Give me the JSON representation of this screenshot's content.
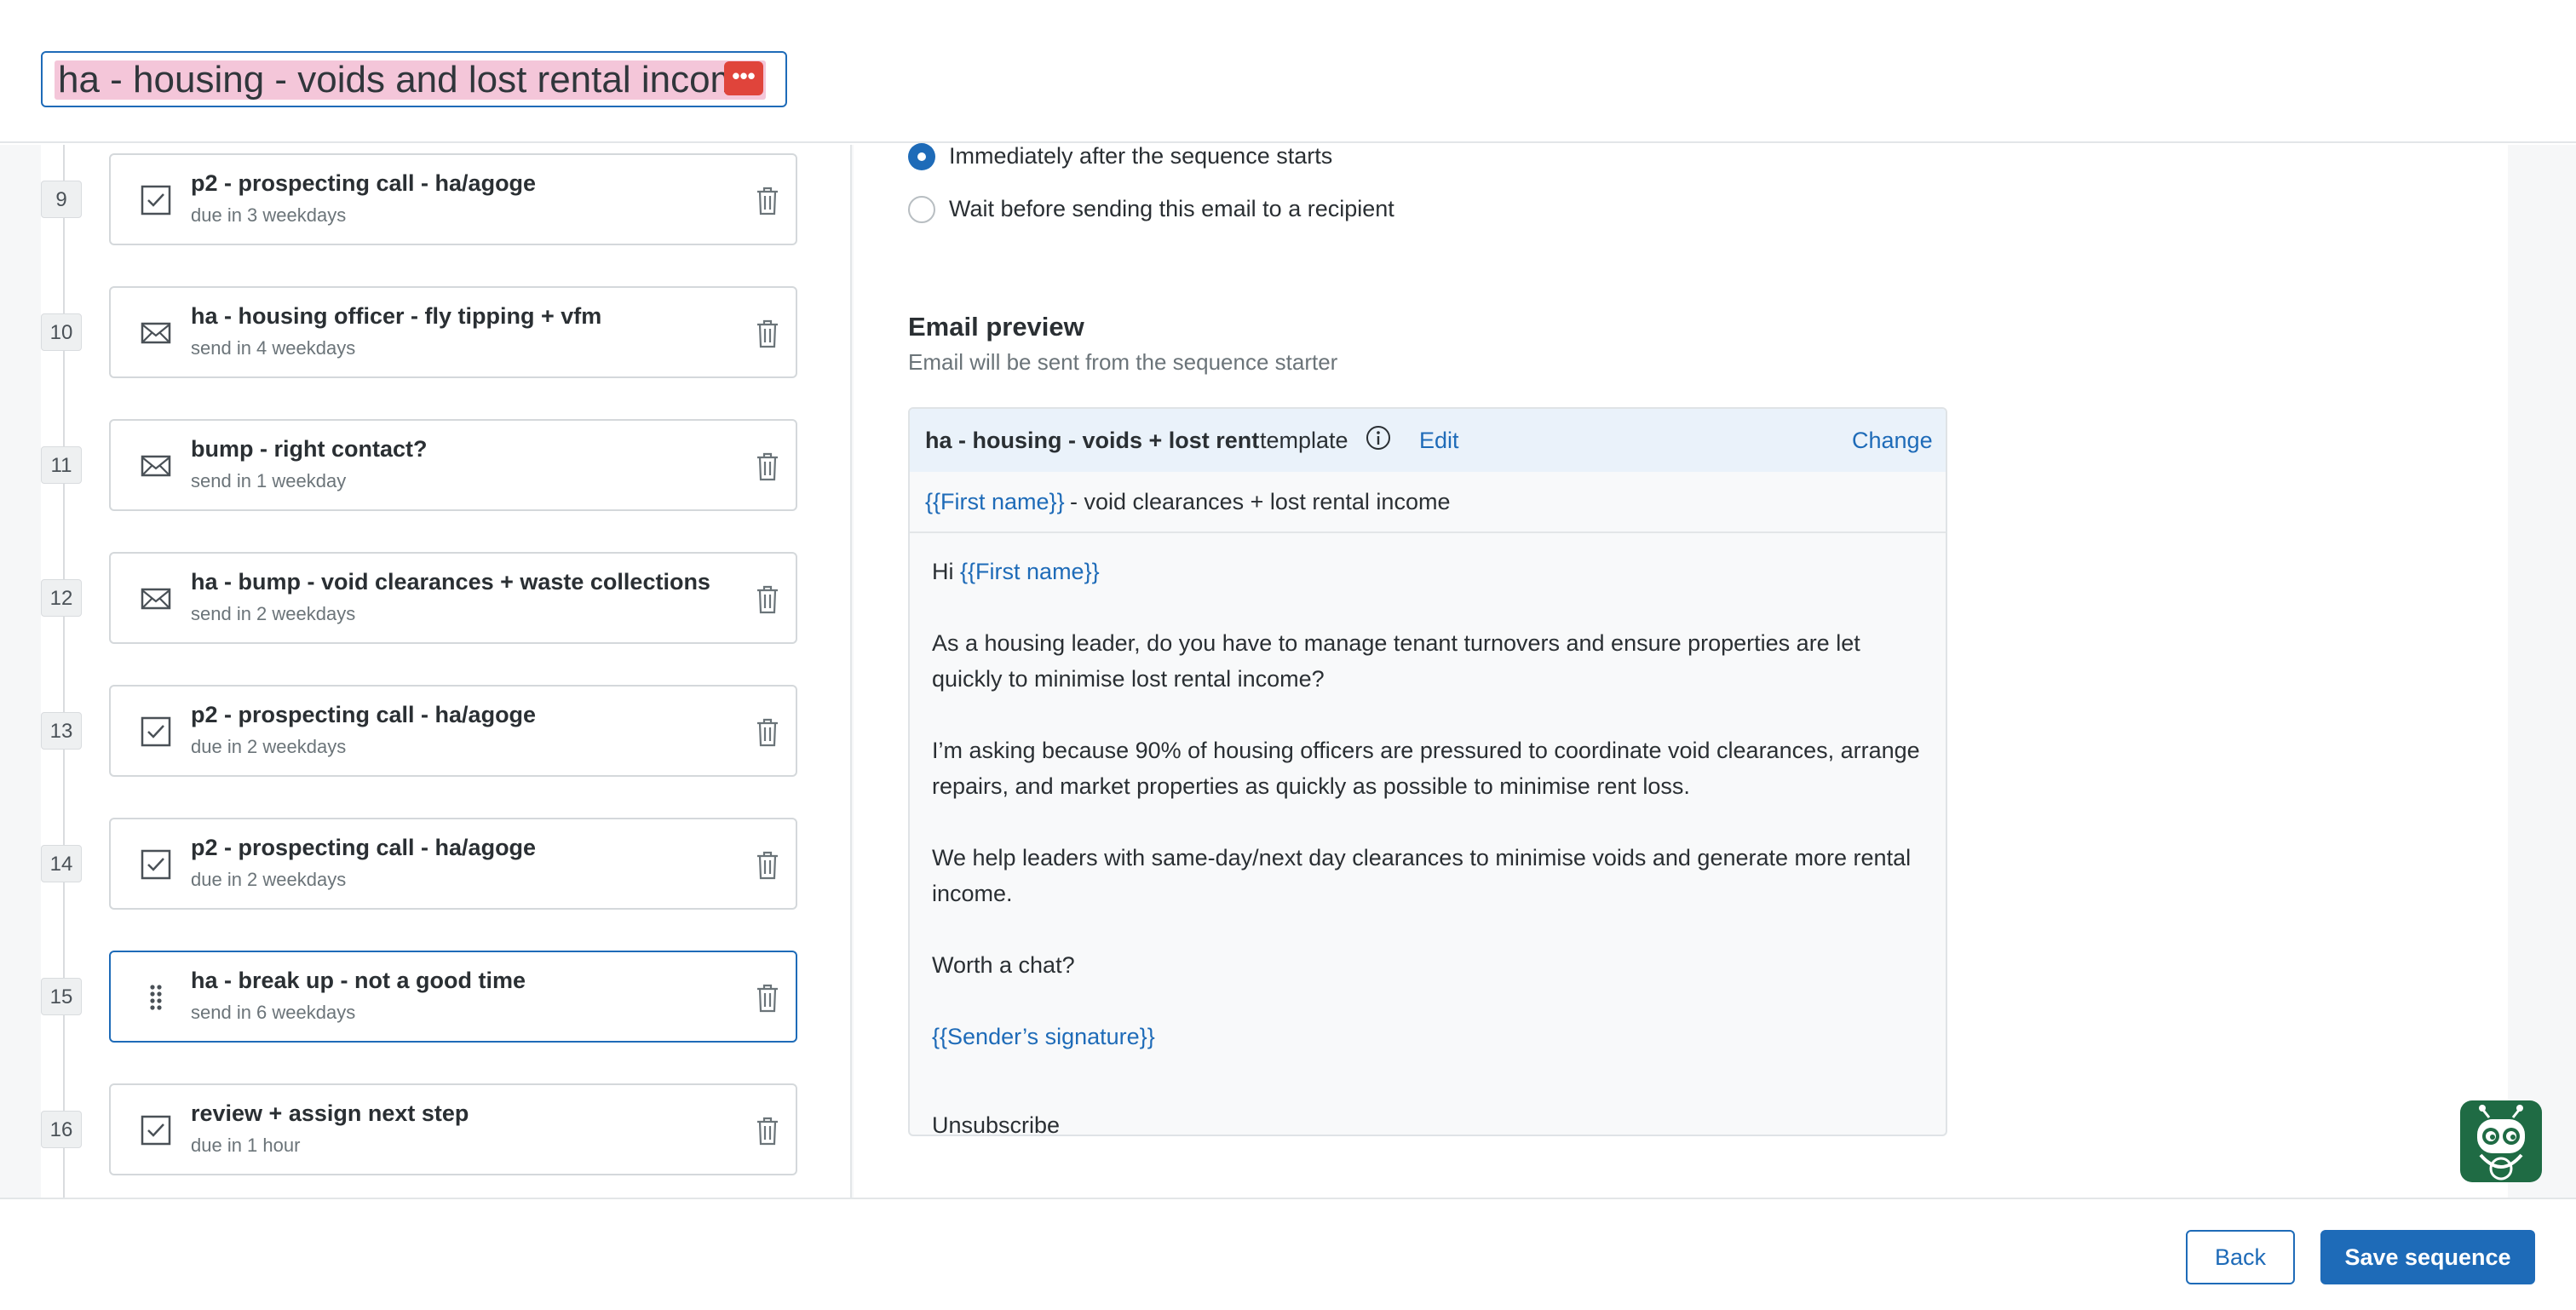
{
  "header": {
    "sequence_title": "ha - housing - voids and lost rental income",
    "extension_badge": "•••"
  },
  "steps": [
    {
      "num": "9",
      "type": "task",
      "title": "p2 - prospecting call - ha/agoge",
      "sub": "due in 3 weekdays"
    },
    {
      "num": "10",
      "type": "email",
      "title": "ha - housing officer - fly tipping + vfm",
      "sub": "send in 4 weekdays"
    },
    {
      "num": "11",
      "type": "email",
      "title": "bump - right contact?",
      "sub": "send in 1 weekday"
    },
    {
      "num": "12",
      "type": "email",
      "title": "ha - bump - void clearances + waste collections",
      "sub": "send in 2 weekdays"
    },
    {
      "num": "13",
      "type": "task",
      "title": "p2 - prospecting call - ha/agoge",
      "sub": "due in 2 weekdays"
    },
    {
      "num": "14",
      "type": "task",
      "title": "p2 - prospecting call - ha/agoge",
      "sub": "due in 2 weekdays"
    },
    {
      "num": "15",
      "type": "drag",
      "title": "ha - break up - not a good time",
      "sub": "send in 6 weekdays"
    },
    {
      "num": "16",
      "type": "task",
      "title": "review + assign next step",
      "sub": "due in 1 hour"
    }
  ],
  "timing": {
    "option_immediate": "Immediately after the sequence starts",
    "option_wait": "Wait before sending this email to a recipient"
  },
  "preview": {
    "title": "Email preview",
    "subtitle": "Email will be sent from the sequence starter",
    "template_name": "ha - housing - voids + lost rent",
    "template_word": "template",
    "edit_label": "Edit",
    "change_label": "Change",
    "subject_var": "{{First name}}",
    "subject_text": "- void clearances + lost rental income",
    "greeting": "Hi",
    "greeting_var": "{{First name}}",
    "para1": "As a housing leader, do you have to manage tenant turnovers and ensure properties are let quickly to minimise lost rental income?",
    "para2": "I’m asking because 90% of housing officers are pressured to coordinate void clearances, arrange repairs, and market properties as quickly as possible to minimise rent loss.",
    "para3": "We help leaders with same-day/next day clearances to minimise voids and generate more rental income.",
    "para4": "Worth a chat?",
    "signature": "{{Sender’s signature}}",
    "unsubscribe": "Unsubscribe"
  },
  "footer": {
    "back_label": "Back",
    "save_label": "Save sequence"
  },
  "colors": {
    "accent": "#1e6bb8",
    "highlight": "#f4c6d9",
    "badge": "#e0443b",
    "robot": "#1f6b44"
  }
}
